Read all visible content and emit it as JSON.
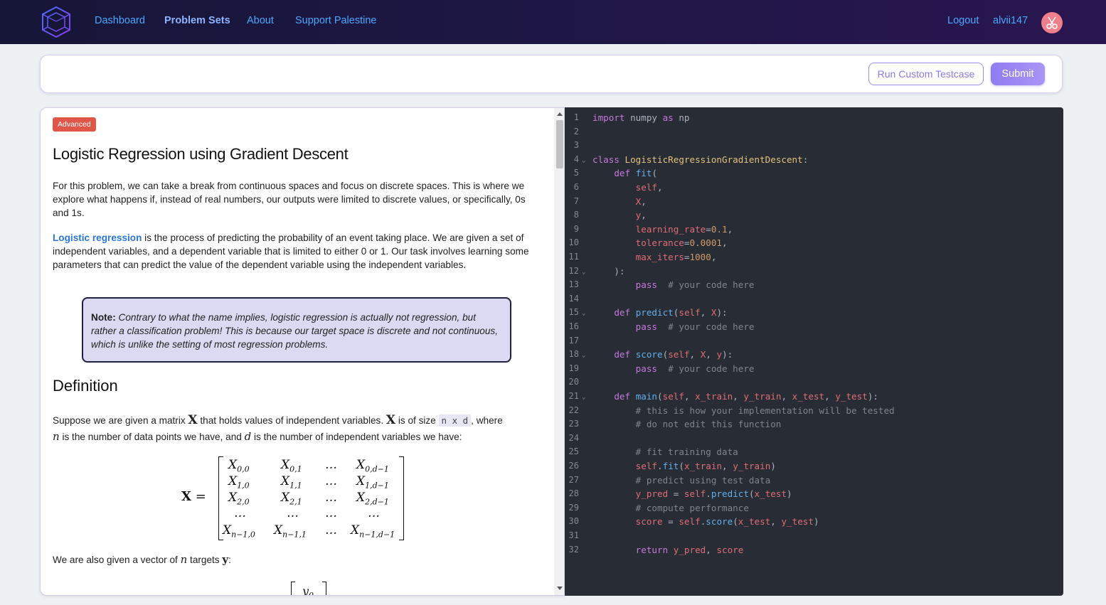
{
  "nav": {
    "links": [
      "Dashboard",
      "Problem Sets",
      "About",
      "Support Palestine"
    ],
    "active": "Problem Sets",
    "logout": "Logout",
    "username": "alvii147"
  },
  "actions": {
    "run_custom": "Run Custom Testcase",
    "submit": "Submit"
  },
  "problem": {
    "difficulty": "Advanced",
    "title": "Logistic Regression using Gradient Descent",
    "intro": "For this problem, we can take a break from continuous spaces and focus on discrete spaces. This is where we explore what happens if, instead of real numbers, our outputs were limited to discrete values, or specifically, 0s and 1s.",
    "p2_link": "Logistic regression",
    "p2_rest": " is the process of predicting the probability of an event taking place. We are given a set of independent variables, and a dependent variable that is limited to either 0 or 1. Our task involves learning some parameters that can predict the value of the dependent variable using the independent variables.",
    "note_label": "Note:",
    "note_text": " Contrary to what the name implies, logistic regression is actually not regression, but rather a classification problem! This is because our target space is discrete and not continuous, which is unlike the setting of most regression problems.",
    "definition_heading": "Definition",
    "def_a": "Suppose we are given a matrix ",
    "def_X": "X",
    "def_b": " that holds values of independent variables. ",
    "def_X2": "X",
    "def_c": " is of size ",
    "def_size": "n x d",
    "def_d": ", where",
    "def_n": "n",
    "def_e": " is the number of data points we have, and ",
    "def_dv": "d",
    "def_f": " is the number of independent variables we have:",
    "targets_a": "We are also given a vector of ",
    "targets_n": "n",
    "targets_b": " targets ",
    "targets_y": "y",
    "targets_c": ":",
    "matrix_lhs": "X",
    "matrix_eq": "=",
    "matrix_rows": [
      [
        "X",
        "0,0",
        "X",
        "0,1",
        "…",
        "X",
        "0,d−1"
      ],
      [
        "X",
        "1,0",
        "X",
        "1,1",
        "…",
        "X",
        "1,d−1"
      ],
      [
        "X",
        "2,0",
        "X",
        "2,1",
        "…",
        "X",
        "2,d−1"
      ],
      [
        "…",
        "",
        "…",
        "",
        "…",
        "…",
        ""
      ],
      [
        "X",
        "n−1,0",
        "X",
        "n−1,1",
        "…",
        "X",
        "n−1,d−1"
      ]
    ],
    "vector_first": "y",
    "vector_first_sub": "0"
  },
  "editor": {
    "line_numbers": [
      "1",
      "2",
      "3",
      "4",
      "5",
      "6",
      "7",
      "8",
      "9",
      "10",
      "11",
      "12",
      "13",
      "14",
      "15",
      "16",
      "17",
      "18",
      "19",
      "20",
      "21",
      "22",
      "23",
      "24",
      "25",
      "26",
      "27",
      "28",
      "29",
      "30",
      "31",
      "32"
    ],
    "fold_lines": [
      4,
      12,
      15,
      18,
      21
    ]
  }
}
